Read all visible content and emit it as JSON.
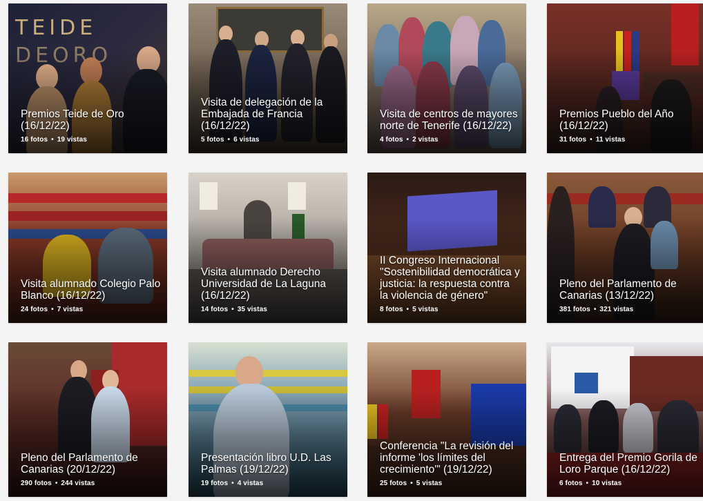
{
  "gallery": {
    "albums": [
      {
        "title": "Premios Teide de Oro (16/12/22)",
        "photos": "16 fotos",
        "views": "19 vistas",
        "bg": "#2a2a3c"
      },
      {
        "title": "Visita de delegación de la Embajada de Francia (16/12/22)",
        "photos": "5 fotos",
        "views": "6 vistas",
        "bg": "#4a3a2c"
      },
      {
        "title": "Visita de centros de mayores norte de Tenerife (16/12/22)",
        "photos": "4 fotos",
        "views": "2 vistas",
        "bg": "#5a5048"
      },
      {
        "title": "Premios Pueblo del Año (16/12/22)",
        "photos": "31 fotos",
        "views": "11 vistas",
        "bg": "#5a2a22"
      },
      {
        "title": "Visita alumnado Colegio Palo Blanco (16/12/22)",
        "photos": "24 fotos",
        "views": "7 vistas",
        "bg": "#6a3020"
      },
      {
        "title": "Visita alumnado Derecho Universidad de La Laguna (16/12/22)",
        "photos": "14 fotos",
        "views": "35 vistas",
        "bg": "#6a6a66"
      },
      {
        "title": "II Congreso Internacional \"Sostenibilidad democrática y justicia: la respuesta contra la violencia de género\"",
        "photos": "8 fotos",
        "views": "5 vistas",
        "bg": "#3a2418"
      },
      {
        "title": "Pleno del Parlamento de Canarias (13/12/22)",
        "photos": "381 fotos",
        "views": "321 vistas",
        "bg": "#5a3424"
      },
      {
        "title": "Pleno del Parlamento de Canarias (20/12/22)",
        "photos": "290 fotos",
        "views": "244 vistas",
        "bg": "#5a2420"
      },
      {
        "title": "Presentación libro U.D. Las Palmas (19/12/22)",
        "photos": "19 fotos",
        "views": "4 vistas",
        "bg": "#3a5a6a"
      },
      {
        "title": "Conferencia \"La revisión del informe 'los límites del crecimiento'\" (19/12/22)",
        "photos": "25 fotos",
        "views": "5 vistas",
        "bg": "#5a3a2a"
      },
      {
        "title": "Entrega del Premio Gorila de Loro Parque (16/12/22)",
        "photos": "6 fotos",
        "views": "10 vistas",
        "bg": "#4a4a52"
      }
    ]
  }
}
